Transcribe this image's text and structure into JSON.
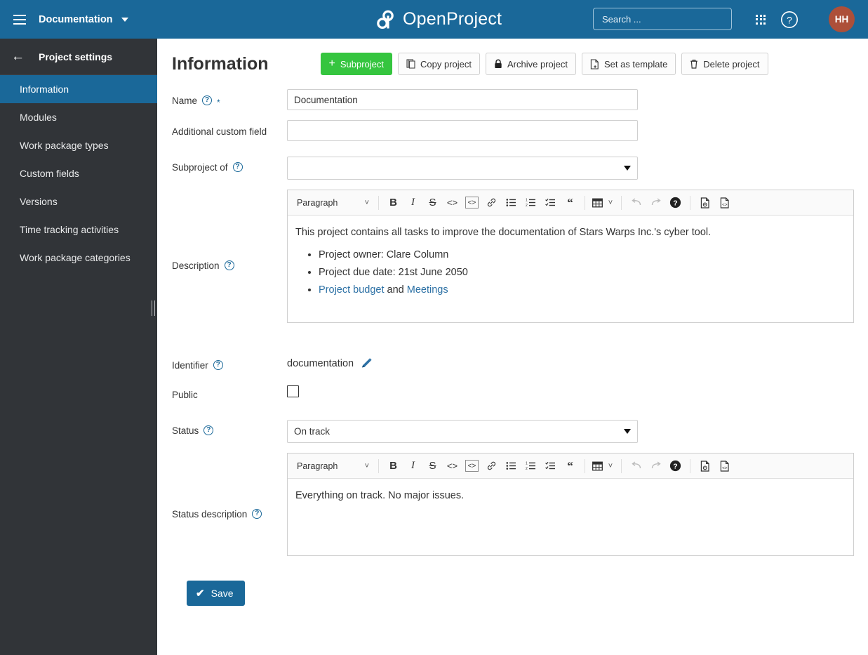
{
  "header": {
    "project_name": "Documentation",
    "logo_text": "OpenProject",
    "search_placeholder": "Search ...",
    "avatar_initials": "HH",
    "colors": {
      "header_bg": "#1a6899",
      "avatar_bg": "#ad4f39",
      "accent": "#1a6899",
      "green": "#35c53f"
    }
  },
  "sidebar": {
    "title": "Project settings",
    "items": [
      {
        "label": "Information",
        "active": true
      },
      {
        "label": "Modules",
        "active": false
      },
      {
        "label": "Work package types",
        "active": false
      },
      {
        "label": "Custom fields",
        "active": false
      },
      {
        "label": "Versions",
        "active": false
      },
      {
        "label": "Time tracking activities",
        "active": false
      },
      {
        "label": "Work package categories",
        "active": false
      }
    ]
  },
  "main": {
    "page_title": "Information",
    "toolbar": {
      "subproject_label": "Subproject",
      "copy_project_label": "Copy project",
      "archive_project_label": "Archive project",
      "set_as_template_label": "Set as template",
      "delete_project_label": "Delete project"
    },
    "form": {
      "name": {
        "label": "Name",
        "value": "Documentation",
        "required_marker": "*"
      },
      "additional_custom_field": {
        "label": "Additional custom field",
        "value": "",
        "placeholder": ""
      },
      "subproject_of": {
        "label": "Subproject of",
        "value": ""
      },
      "description": {
        "label": "Description",
        "paragraph": "This project contains all tasks to improve the documentation of Stars Warps Inc.'s cyber tool.",
        "bullets": [
          {
            "text": "Project owner: Clare Column"
          },
          {
            "text": "Project due date: 21st June 2050"
          }
        ],
        "link_bullet": {
          "link1": "Project budget",
          "conjunction": " and ",
          "link2": "Meetings"
        }
      },
      "identifier": {
        "label": "Identifier",
        "value": "documentation"
      },
      "public": {
        "label": "Public",
        "checked": false
      },
      "status": {
        "label": "Status",
        "value": "On track"
      },
      "status_description": {
        "label": "Status description",
        "text": "Everything on track. No major issues."
      }
    },
    "editor_toolbar": {
      "style_label": "Paragraph",
      "buttons": [
        "bold",
        "italic",
        "strikethrough",
        "inline-code",
        "code-block",
        "link",
        "bulleted-list",
        "numbered-list",
        "todo-list",
        "blockquote",
        "table",
        "undo",
        "redo",
        "help",
        "preview",
        "markdown-source"
      ]
    },
    "save_label": "Save"
  }
}
